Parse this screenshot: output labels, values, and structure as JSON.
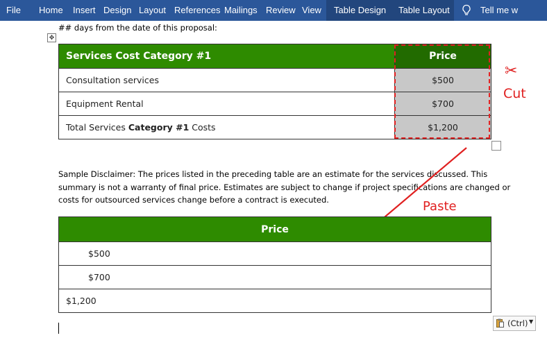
{
  "ribbon": {
    "tabs": [
      "File",
      "Home",
      "Insert",
      "Design",
      "Layout",
      "References",
      "Mailings",
      "Review",
      "View",
      "Table Design",
      "Table Layout"
    ],
    "tell_me": "Tell me w"
  },
  "document": {
    "intro_line": "## days from the date of this proposal:",
    "table1": {
      "header_category": "Services Cost Category #1",
      "header_price": "Price",
      "rows": [
        {
          "label": "Consultation services",
          "price": "$500"
        },
        {
          "label": "Equipment Rental",
          "price": "$700"
        },
        {
          "label_prefix": "Total Services ",
          "label_bold": "Category #1",
          "label_suffix": " Costs",
          "price": "$1,200"
        }
      ]
    },
    "disclaimer_lines": [
      "Sample Disclaimer: The prices listed in the preceding table are an estimate for the services discussed. This",
      "summary is not a warranty of final price. Estimates are subject to change if project specifications are changed or",
      "costs for outsourced services change before a contract is executed."
    ],
    "table2": {
      "header": "Price",
      "rows": [
        "$500",
        "$700",
        "$1,200"
      ]
    }
  },
  "annotations": {
    "cut_symbol": "✂",
    "cut_label": "Cut",
    "paste_label": "Paste",
    "accent_color": "#e02020"
  },
  "paste_options": {
    "label": "(Ctrl)",
    "icon": "clipboard-icon"
  },
  "colors": {
    "ribbon": "#2b579a",
    "table_header": "#2e8b00",
    "selected_cell": "#c8c8c8"
  }
}
